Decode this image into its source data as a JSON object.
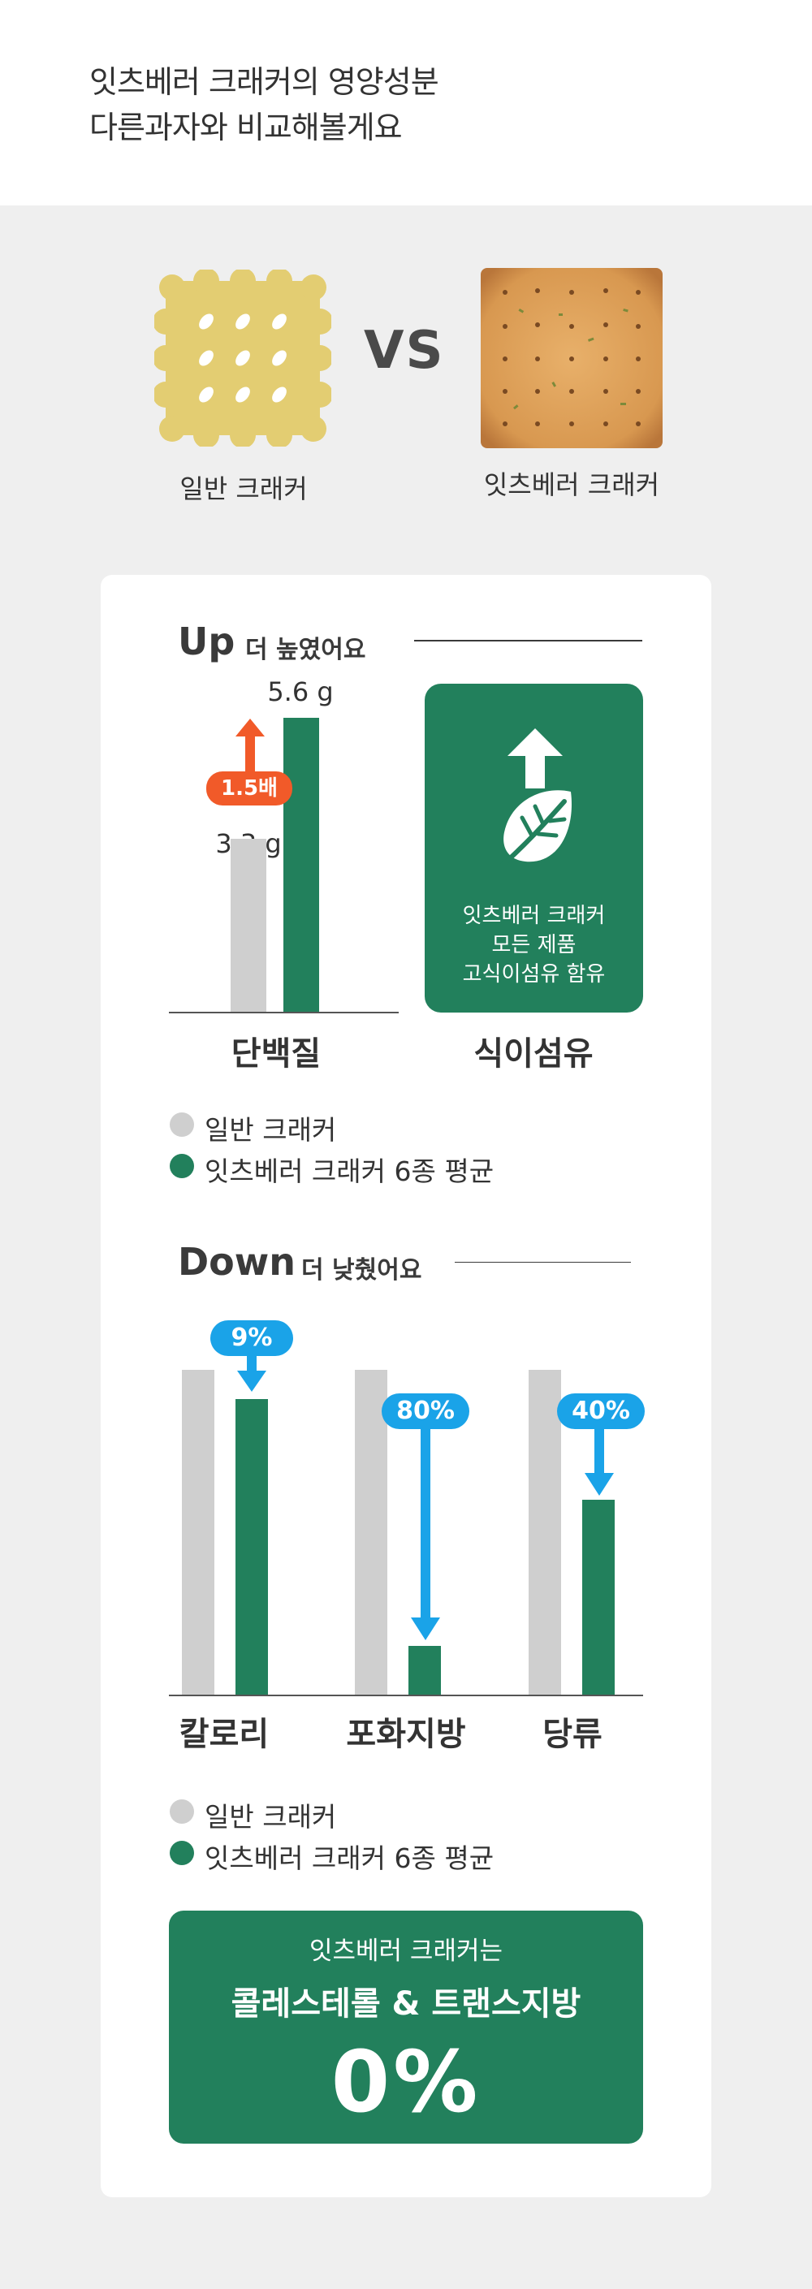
{
  "header": {
    "title_line1": "잇츠베러 크래커의 영양성분",
    "title_line2": "다른과자와 비교해볼게요"
  },
  "comparison": {
    "left_label": "일반 크래커",
    "vs_label": "VS",
    "right_label": "잇츠베러 크래커"
  },
  "up_section": {
    "title": "Up",
    "subtitle": "더 높였어요",
    "protein": {
      "regular_value": 3.3,
      "regular_label": "3.3 g",
      "itsbetter_value": 5.6,
      "itsbetter_label": "5.6 g",
      "multiplier_label": "1.5배",
      "category": "단백질"
    },
    "fiber": {
      "line1": "잇츠베러 크래커",
      "line2": "모든 제품",
      "line3": "고식이섬유 함유",
      "category": "식이섬유"
    },
    "legend": [
      "일반 크래커",
      "잇츠베러 크래커 6종 평균"
    ]
  },
  "down_section": {
    "title": "Down",
    "subtitle": "더 낮췄어요",
    "items": [
      {
        "category": "칼로리",
        "badge": "9%",
        "regular_level": 1.0,
        "itsbetter_level": 0.91
      },
      {
        "category": "포화지방",
        "badge": "80%",
        "regular_level": 1.0,
        "itsbetter_level": 0.15
      },
      {
        "category": "당류",
        "badge": "40%",
        "regular_level": 1.0,
        "itsbetter_level": 0.6
      }
    ],
    "legend": [
      "일반 크래커",
      "잇츠베러 크래커 6종 평균"
    ]
  },
  "final": {
    "line1": "잇츠베러 크래커는",
    "line2": "콜레스테롤 & 트랜스지방",
    "line3": "0%"
  },
  "colors": {
    "green": "#22805c",
    "grey": "#cfcfcf",
    "blue": "#1aa3e8",
    "orange": "#f15a29",
    "cracker_yellow": "#e3cd72"
  },
  "chart_data": [
    {
      "type": "bar",
      "categories": [
        "단백질"
      ],
      "series": [
        {
          "name": "일반 크래커",
          "values": [
            3.3
          ]
        },
        {
          "name": "잇츠베러 크래커 6종 평균",
          "values": [
            5.6
          ]
        }
      ],
      "annotations": [
        "1.5배"
      ]
    },
    {
      "type": "bar",
      "categories": [
        "칼로리",
        "포화지방",
        "당류"
      ],
      "series": [
        {
          "name": "일반 크래커",
          "values": [
            100,
            100,
            100
          ]
        },
        {
          "name": "잇츠베러 크래커 6종 평균",
          "values": [
            91,
            20,
            60
          ]
        }
      ],
      "annotations": [
        "9%",
        "80%",
        "40%"
      ]
    }
  ]
}
